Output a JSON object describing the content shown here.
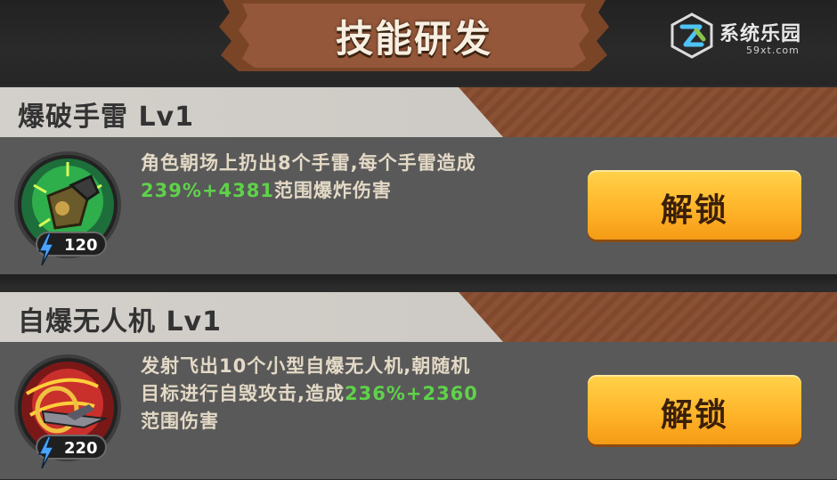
{
  "header": {
    "title": "技能研发"
  },
  "watermark": {
    "name": "系统乐园",
    "url": "59xt.com"
  },
  "skills": [
    {
      "title": "爆破手雷 Lv1",
      "icon": "grenade-icon",
      "cost": "120",
      "desc_before": "角色朝场上扔出8个手雷,每个手雷造成",
      "desc_highlight": "239%+4381",
      "desc_after": "范围爆炸伤害",
      "button_label": "解锁"
    },
    {
      "title": "自爆无人机 Lv1",
      "icon": "drone-icon",
      "cost": "220",
      "desc_before": "发射飞出10个小型自爆无人机,朝随机目标进行自毁攻击,造成",
      "desc_highlight": "236%+2360",
      "desc_after": "范围伤害",
      "button_label": "解锁"
    }
  ],
  "colors": {
    "highlight": "#5fd24a",
    "button": "#ffb52a",
    "stripe": "#8a5134"
  }
}
